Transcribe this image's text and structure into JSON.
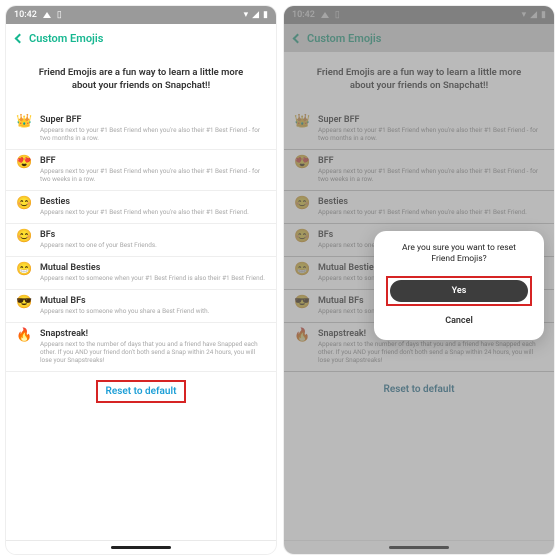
{
  "statusbar": {
    "time": "10:42"
  },
  "title": "Custom Emojis",
  "intro": "Friend Emojis are a fun way to learn a little more about your friends on Snapchat!!",
  "rows": [
    {
      "emoji": "👑",
      "title": "Super BFF",
      "desc": "Appears next to your #1 Best Friend when you're also their #1 Best Friend - for two months in a row."
    },
    {
      "emoji": "😍",
      "title": "BFF",
      "desc": "Appears next to your #1 Best Friend when you're also their #1 Best Friend - for two weeks in a row."
    },
    {
      "emoji": "😊",
      "title": "Besties",
      "desc": "Appears next to your #1 Best Friend when you're also their #1 Best Friend."
    },
    {
      "emoji": "😊",
      "title": "BFs",
      "desc": "Appears next to one of your Best Friends."
    },
    {
      "emoji": "😁",
      "title": "Mutual Besties",
      "desc": "Appears next to someone when your #1 Best Friend is also their #1 Best Friend."
    },
    {
      "emoji": "😎",
      "title": "Mutual BFs",
      "desc": "Appears next to someone who you share a Best Friend with."
    },
    {
      "emoji": "🔥",
      "title": "Snapstreak!",
      "desc": "Appears next to the number of days that you and a friend have Snapped each other. If you AND your friend don't both send a Snap within 24 hours, you will lose your Snapstreaks!"
    }
  ],
  "reset": "Reset to default",
  "dialog": {
    "msg": "Are you sure you want to reset Friend Emojis?",
    "yes": "Yes",
    "cancel": "Cancel"
  }
}
